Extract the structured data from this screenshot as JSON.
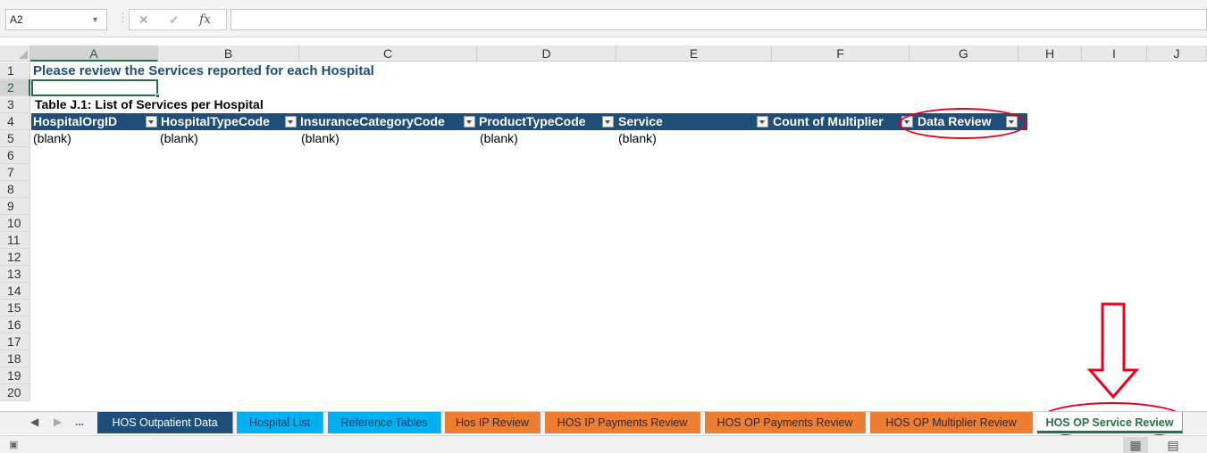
{
  "formula_bar": {
    "name_box": "A2",
    "cancel_icon": "✕",
    "enter_icon": "✓",
    "function_icon": "fx",
    "formula": ""
  },
  "columns": [
    "A",
    "B",
    "C",
    "D",
    "E",
    "F",
    "G",
    "H",
    "I",
    "J"
  ],
  "rows": [
    "1",
    "2",
    "3",
    "4",
    "5",
    "6",
    "7",
    "8",
    "9",
    "10",
    "11",
    "12",
    "13",
    "14",
    "15",
    "16",
    "17",
    "18",
    "19",
    "20"
  ],
  "sheet": {
    "title": "Please review the Services reported for each Hospital",
    "table_caption": "Table J.1: List of Services per Hospital",
    "headers": [
      "HospitalOrgID",
      "HospitalTypeCode",
      "InsuranceCategoryCode",
      "ProductTypeCode",
      "Service",
      "Count of Multiplier",
      "Data Review"
    ],
    "row5": [
      "(blank)",
      "(blank)",
      "(blank)",
      "(blank)",
      "(blank)"
    ]
  },
  "tabs": {
    "ellipsis": "...",
    "items": [
      "HOS Outpatient Data",
      "Hospital List",
      "Reference Tables",
      "Hos IP Review",
      "HOS IP Payments Review",
      "HOS OP Payments Review",
      "HOS OP Multiplier Review",
      "HOS OP Service Review"
    ]
  },
  "colors": {
    "header_fill": "#1f4e79",
    "title_text": "#1f4e79",
    "selection": "#217346",
    "highlight": "#e8001c",
    "tab_navy": "#1f4e79",
    "tab_cyan": "#00b0f0",
    "tab_orange": "#ed7d31"
  },
  "icons": [
    "dropdown-icon",
    "cancel-icon",
    "enter-icon",
    "function-icon",
    "filter-dropdown-icon",
    "down-arrow-annotation-icon",
    "normal-view-icon",
    "page-layout-view-icon"
  ]
}
